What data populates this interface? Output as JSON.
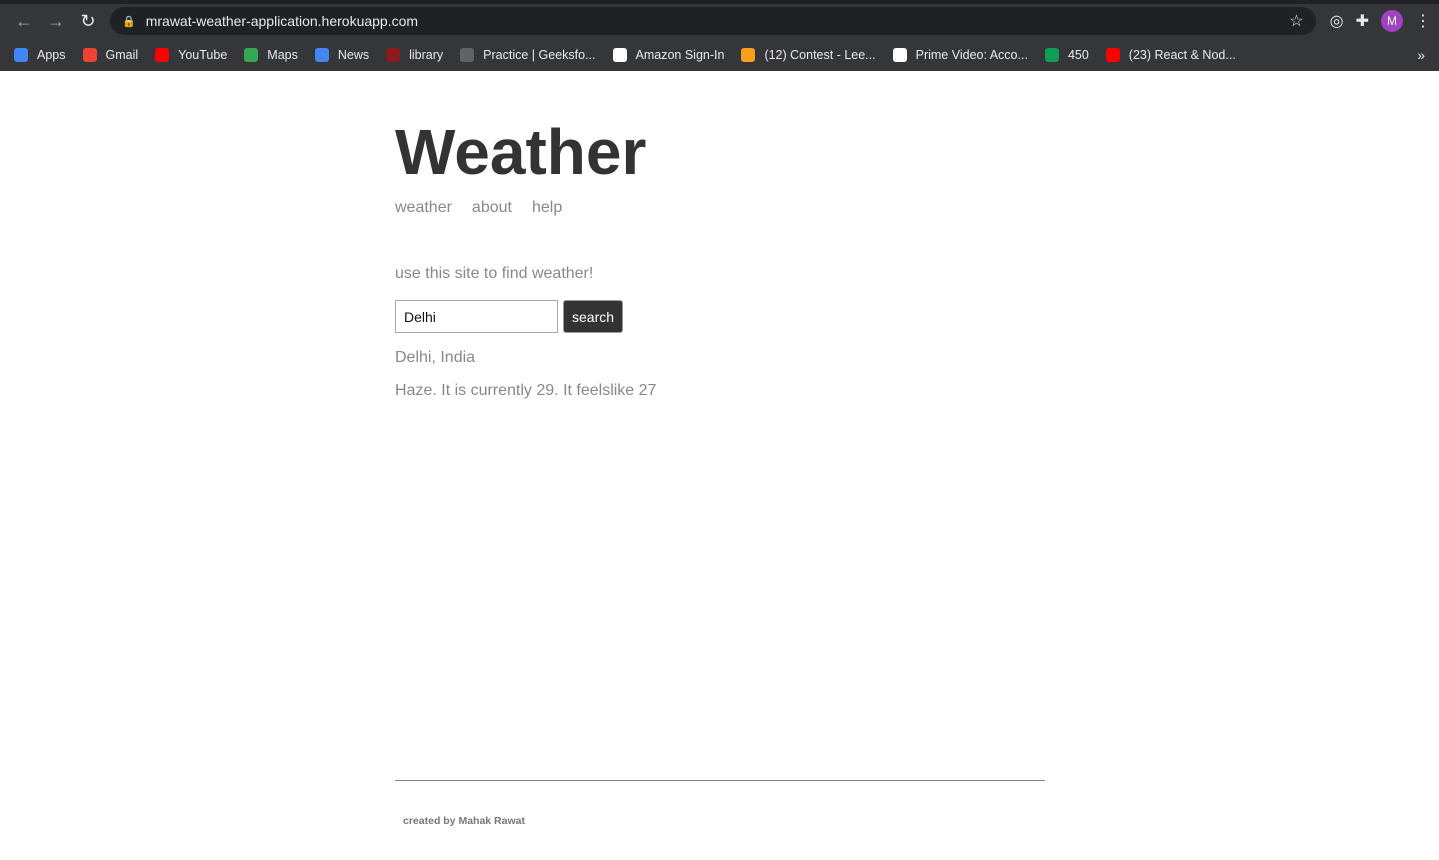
{
  "browser": {
    "url": "mrawat-weather-application.herokuapp.com",
    "profile_initial": "M",
    "bookmarks": [
      {
        "label": "Apps",
        "icon": "apps-grid-icon",
        "color": "#4285f4"
      },
      {
        "label": "Gmail",
        "icon": "gmail-icon",
        "color": "#ea4335"
      },
      {
        "label": "YouTube",
        "icon": "youtube-icon",
        "color": "#ff0000"
      },
      {
        "label": "Maps",
        "icon": "maps-pin-icon",
        "color": "#34a853"
      },
      {
        "label": "News",
        "icon": "google-news-icon",
        "color": "#4285f4"
      },
      {
        "label": "library",
        "icon": "library-icon",
        "color": "#8b1a1a"
      },
      {
        "label": "Practice | Geeksfo...",
        "icon": "globe-icon",
        "color": "#5f6368"
      },
      {
        "label": "Amazon Sign-In",
        "icon": "amazon-icon",
        "color": "#ffffff"
      },
      {
        "label": "(12) Contest - Lee...",
        "icon": "leetcode-icon",
        "color": "#f89f1b"
      },
      {
        "label": "Prime Video: Acco...",
        "icon": "amazon-icon",
        "color": "#ffffff"
      },
      {
        "label": "450",
        "icon": "sheets-icon",
        "color": "#0f9d58"
      },
      {
        "label": "(23) React & Nod...",
        "icon": "youtube-icon",
        "color": "#ff0000"
      }
    ]
  },
  "page": {
    "title": "Weather",
    "nav": [
      "weather",
      "about",
      "help"
    ],
    "intro": "use this site to find weather!",
    "search": {
      "value": "Delhi",
      "button": "search"
    },
    "location": "Delhi, India",
    "forecast": "Haze. It is currently 29. It feelslike 27",
    "footer": "created by Mahak Rawat"
  }
}
